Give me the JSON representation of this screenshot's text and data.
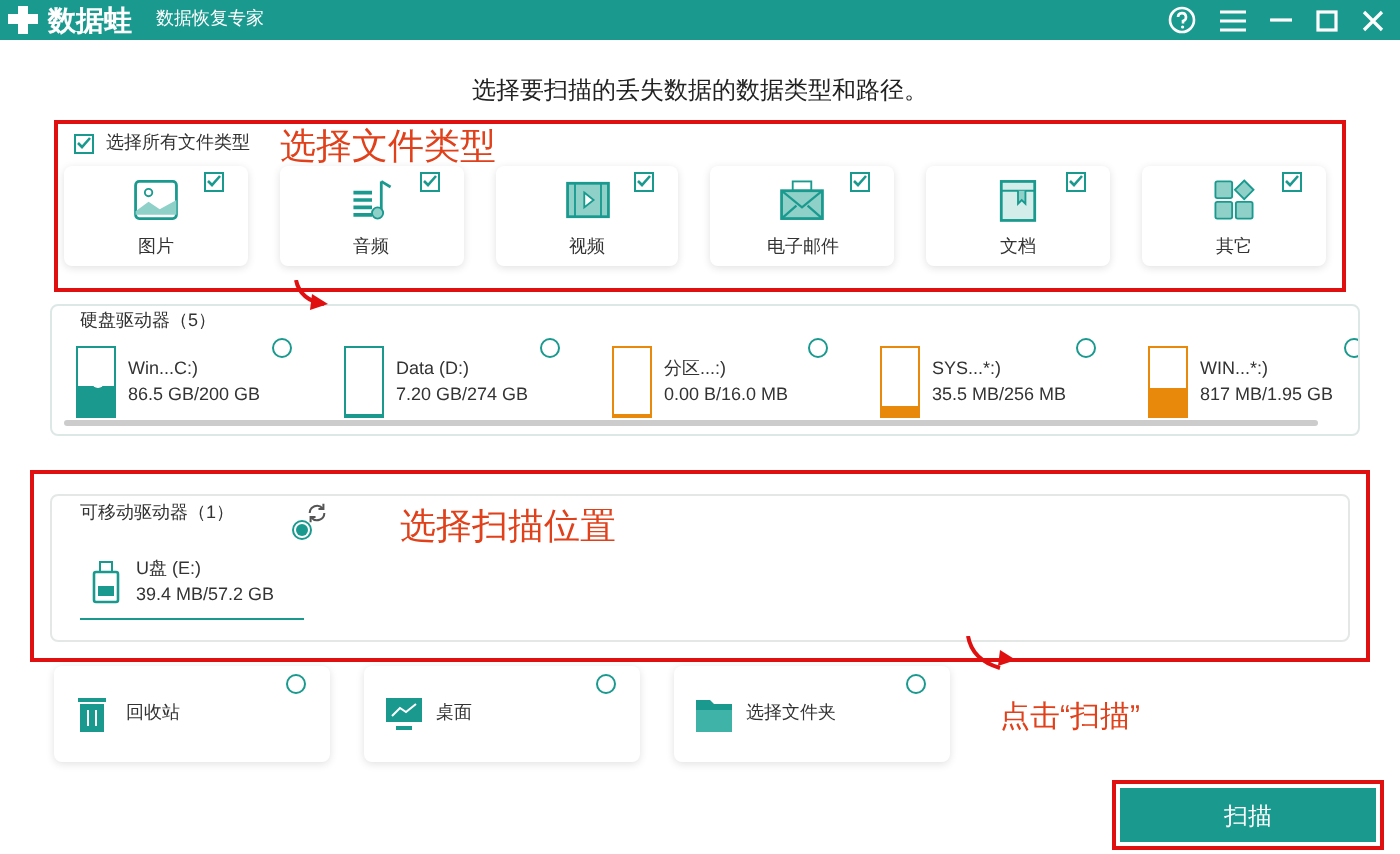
{
  "window": {
    "title": "数据蛙",
    "subtitle": "数据恢复专家"
  },
  "heading": "选择要扫描的丢失数据的数据类型和路径。",
  "select_all": {
    "label": "选择所有文件类型",
    "checked": true
  },
  "file_types": [
    {
      "kind": "image",
      "label": "图片",
      "checked": true
    },
    {
      "kind": "audio",
      "label": "音频",
      "checked": true
    },
    {
      "kind": "video",
      "label": "视频",
      "checked": true
    },
    {
      "kind": "mail",
      "label": "电子邮件",
      "checked": true
    },
    {
      "kind": "document",
      "label": "文档",
      "checked": true
    },
    {
      "kind": "other",
      "label": "其它",
      "checked": true
    }
  ],
  "hard_drives": {
    "title": "硬盘驱动器（5）",
    "items": [
      {
        "name": "Win...C:)",
        "usage": "86.5 GB/200 GB",
        "level": 0.43,
        "color": "#1a9a8f",
        "os": true,
        "selected": false
      },
      {
        "name": "Data (D:)",
        "usage": "7.20 GB/274 GB",
        "level": 0.03,
        "color": "#1a9a8f",
        "os": false,
        "selected": false
      },
      {
        "name": "分区...:)",
        "usage": "0.00  B/16.0 MB",
        "level": 0,
        "color": "#e8890c",
        "os": false,
        "selected": false
      },
      {
        "name": "SYS...*:)",
        "usage": "35.5 MB/256 MB",
        "level": 0.15,
        "color": "#e8890c",
        "os": false,
        "selected": false
      },
      {
        "name": "WIN...*:)",
        "usage": "817 MB/1.95 GB",
        "level": 0.4,
        "color": "#e8890c",
        "os": false,
        "selected": false
      }
    ]
  },
  "removable_drives": {
    "title": "可移动驱动器（1）",
    "items": [
      {
        "name": "U盘 (E:)",
        "usage": "39.4 MB/57.2 GB",
        "selected": true
      }
    ]
  },
  "locations": [
    {
      "kind": "recycle",
      "label": "回收站",
      "selected": false
    },
    {
      "kind": "desktop",
      "label": "桌面",
      "selected": false
    },
    {
      "kind": "folder",
      "label": "选择文件夹",
      "selected": false
    }
  ],
  "scan_button": "扫描",
  "annotations": [
    {
      "kind": "file_types",
      "text": "选择文件类型"
    },
    {
      "kind": "location",
      "text": "选择扫描位置"
    },
    {
      "kind": "scan",
      "text": "点击“扫描”"
    }
  ]
}
